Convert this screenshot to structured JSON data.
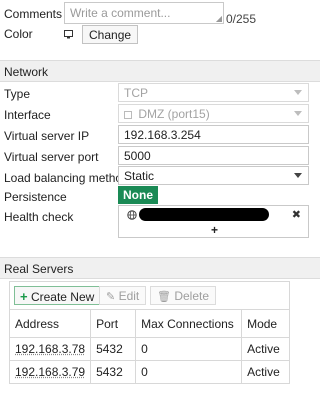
{
  "general": {
    "comments_label": "Comments",
    "comments_placeholder": "Write a comment...",
    "comments_counter": "0/255",
    "color_label": "Color",
    "change_button": "Change"
  },
  "network": {
    "section_title": "Network",
    "type_label": "Type",
    "type_value": "TCP",
    "interface_label": "Interface",
    "interface_value": "DMZ (port15)",
    "vip_label": "Virtual server IP",
    "vip_value": "192.168.3.254",
    "vport_label": "Virtual server port",
    "vport_value": "5000",
    "lb_label": "Load balancing method",
    "lb_value": "Static",
    "persistence_label": "Persistence",
    "persistence_value": "None",
    "health_label": "Health check",
    "health_add": "+",
    "health_remove": "✖"
  },
  "real_servers": {
    "section_title": "Real Servers",
    "toolbar": {
      "create_label": "Create New",
      "edit_label": "Edit",
      "delete_label": "Delete"
    },
    "columns": [
      "Address",
      "Port",
      "Max Connections",
      "Mode"
    ],
    "rows": [
      {
        "address": "192.168.3.78",
        "port": "5432",
        "max_connections": "0",
        "mode": "Active"
      },
      {
        "address": "192.168.3.79",
        "port": "5432",
        "max_connections": "0",
        "mode": "Active"
      }
    ]
  },
  "colors": {
    "accent_green": "#1a9a4a",
    "persistence_bg": "#1a8a55"
  },
  "icons": {
    "color_swatch": "monitor-icon",
    "health_item": "globe-icon"
  }
}
